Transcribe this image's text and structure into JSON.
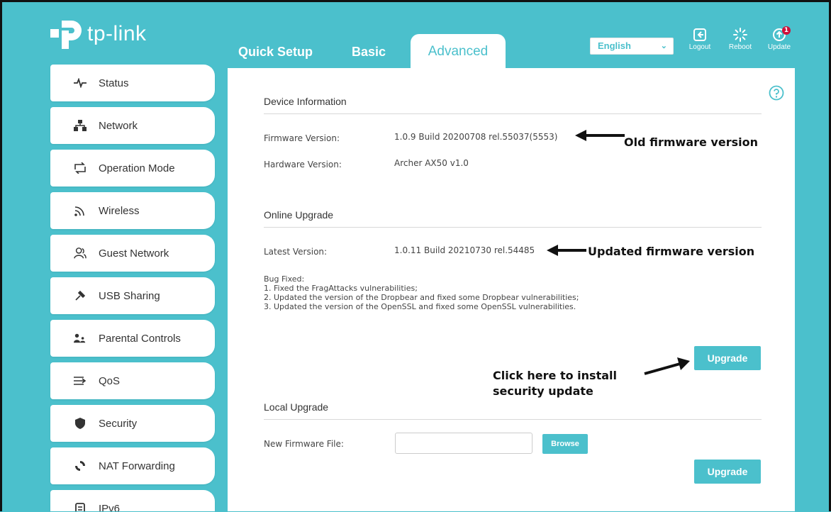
{
  "header": {
    "brand": "tp-link",
    "tabs": {
      "quick_setup": "Quick Setup",
      "basic": "Basic",
      "advanced": "Advanced"
    },
    "language": "English",
    "logout": "Logout",
    "reboot": "Reboot",
    "update": "Update",
    "update_badge": "1"
  },
  "sidebar": {
    "items": [
      {
        "label": "Status",
        "icon": "status-pulse-icon"
      },
      {
        "label": "Network",
        "icon": "network-icon"
      },
      {
        "label": "Operation Mode",
        "icon": "operation-mode-icon"
      },
      {
        "label": "Wireless",
        "icon": "wireless-icon"
      },
      {
        "label": "Guest Network",
        "icon": "guest-network-icon"
      },
      {
        "label": "USB Sharing",
        "icon": "usb-icon"
      },
      {
        "label": "Parental Controls",
        "icon": "parental-controls-icon"
      },
      {
        "label": "QoS",
        "icon": "qos-icon"
      },
      {
        "label": "Security",
        "icon": "shield-icon"
      },
      {
        "label": "NAT Forwarding",
        "icon": "nat-forwarding-icon"
      },
      {
        "label": "IPv6",
        "icon": "ipv6-icon"
      }
    ]
  },
  "device_info": {
    "title": "Device Information",
    "firmware_label": "Firmware Version:",
    "firmware_value": "1.0.9 Build 20200708 rel.55037(5553)",
    "hardware_label": "Hardware Version:",
    "hardware_value": "Archer AX50 v1.0"
  },
  "online_upgrade": {
    "title": "Online Upgrade",
    "latest_label": "Latest Version:",
    "latest_value": "1.0.11 Build 20210730 rel.54485",
    "bug_title": "Bug Fixed:",
    "bug_notes": [
      "1. Fixed the FragAttacks vulnerabilities;",
      "2. Updated the version of the Dropbear and fixed some Dropbear vulnerabilities;",
      "3. Updated the version of the OpenSSL and fixed some OpenSSL vulnerabilities."
    ],
    "upgrade_button": "Upgrade"
  },
  "local_upgrade": {
    "title": "Local Upgrade",
    "file_label": "New Firmware File:",
    "file_value": "",
    "browse_button": "Browse",
    "upgrade_button": "Upgrade"
  },
  "annotations": {
    "old_firmware": "Old firmware version",
    "updated_firmware": "Updated firmware version",
    "install_line1": "Click here to install",
    "install_line2": "security update"
  },
  "colors": {
    "accent": "#4bc0cc",
    "badge": "#d0103a"
  }
}
